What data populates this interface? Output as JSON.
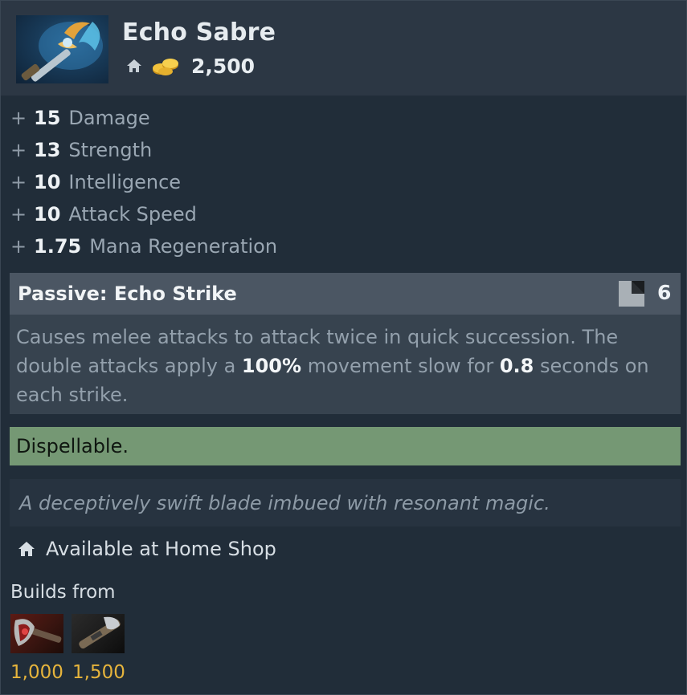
{
  "item": {
    "name": "Echo Sabre",
    "cost": "2,500",
    "icon": "echo-sabre-icon"
  },
  "stats": [
    {
      "plus": "+",
      "value": "15",
      "name": "Damage"
    },
    {
      "plus": "+",
      "value": "13",
      "name": "Strength"
    },
    {
      "plus": "+",
      "value": "10",
      "name": "Intelligence"
    },
    {
      "plus": "+",
      "value": "10",
      "name": "Attack Speed"
    },
    {
      "plus": "+",
      "value": "1.75",
      "name": "Mana Regeneration"
    }
  ],
  "ability": {
    "title": "Passive: Echo Strike",
    "cooldown": "6",
    "desc_part1": "Causes melee attacks to attack twice in quick succession. The double attacks apply a ",
    "slow_value": "100%",
    "desc_part2": " movement slow for ",
    "slow_duration": "0.8",
    "desc_part3": " seconds on each strike."
  },
  "dispellable": "Dispellable.",
  "lore": "A deceptively swift blade imbued with resonant magic.",
  "availability": "Available at Home Shop",
  "builds": {
    "label": "Builds from",
    "components": [
      {
        "icon": "ogre-axe-icon",
        "cost": "1,000"
      },
      {
        "icon": "oblivion-staff-icon",
        "cost": "1,500"
      }
    ]
  },
  "colors": {
    "background": "#212d39",
    "header": "#2c3744",
    "ability_head": "#4b5663",
    "dispellable": "#759874",
    "gold": "#e6b43c"
  }
}
